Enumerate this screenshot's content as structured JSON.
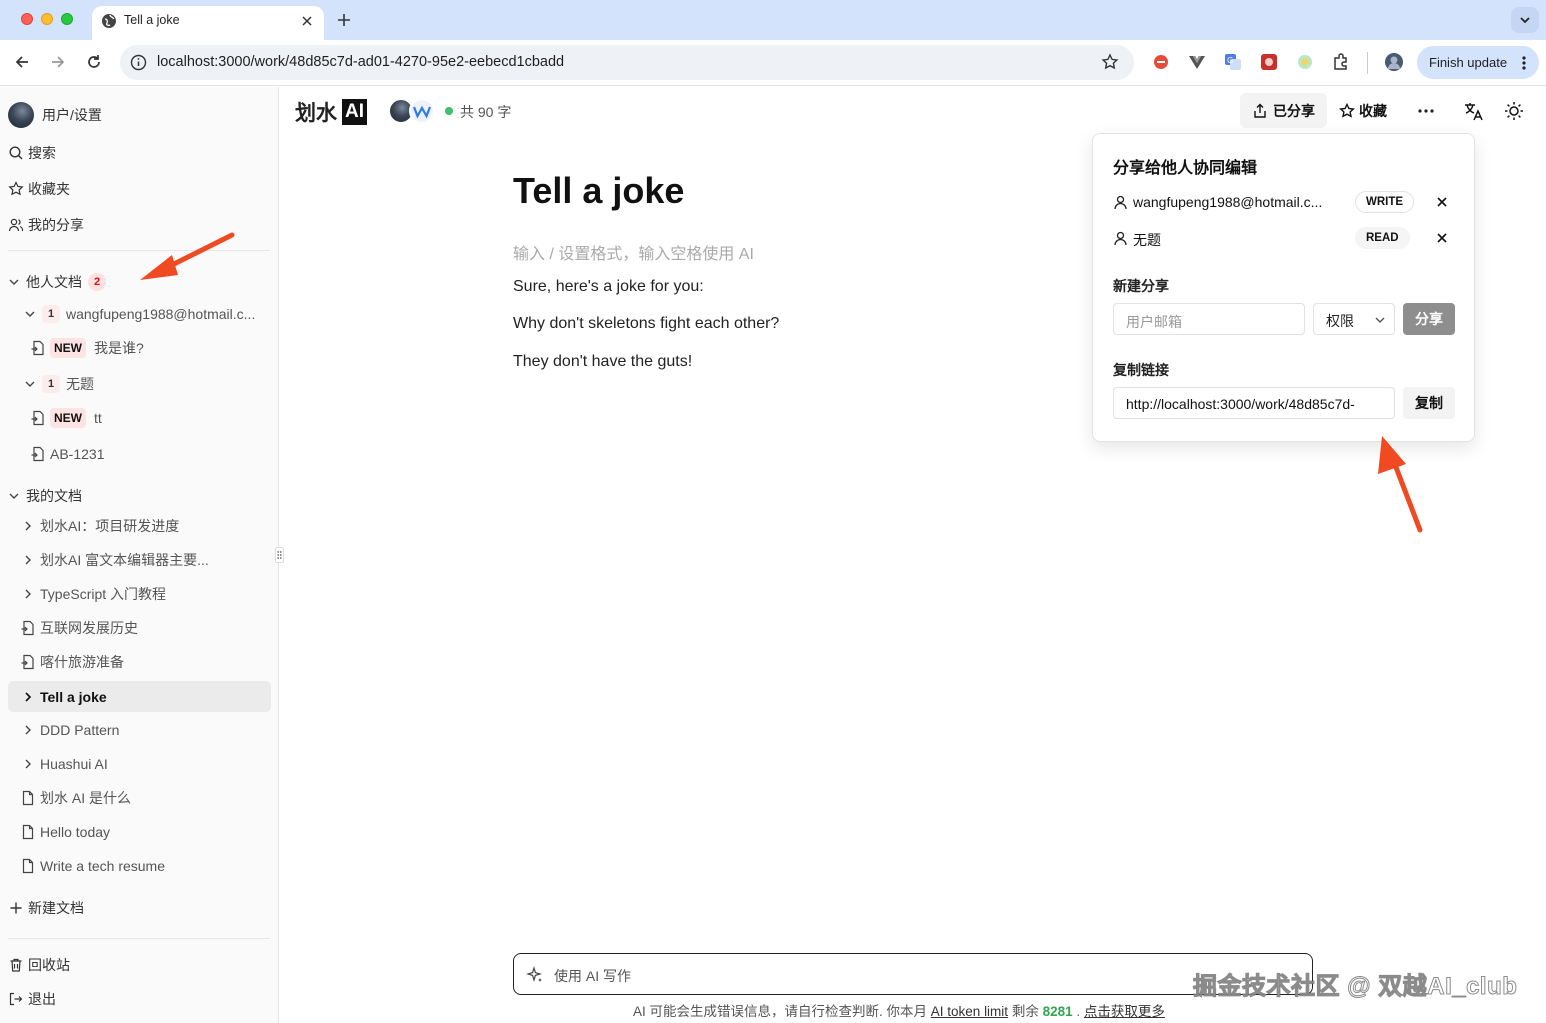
{
  "browser": {
    "tab_title": "Tell a joke",
    "url": "localhost:3000/work/48d85c7d-ad01-4270-95e2-eebecd1cbadd",
    "finish_update": "Finish update"
  },
  "sidebar": {
    "user_settings": "用户/设置",
    "search": "搜索",
    "favorites": "收藏夹",
    "my_shares": "我的分享",
    "others_docs": {
      "label": "他人文档",
      "count": "2"
    },
    "shared_groups": [
      {
        "count": "1",
        "owner": "wangfupeng1988@hotmail.c...",
        "doc_badge": "NEW",
        "doc_title": "我是谁?"
      },
      {
        "count": "1",
        "owner": "无题",
        "doc_badge": "NEW",
        "doc_title": "tt"
      }
    ],
    "shared_extra_doc": "AB-1231",
    "my_docs": {
      "label": "我的文档",
      "items": [
        "划水AI：项目研发进度",
        "划水AI 富文本编辑器主要...",
        "TypeScript 入门教程",
        "互联网发展历史",
        "喀什旅游准备",
        "Tell a joke",
        "DDD Pattern",
        "Huashui AI",
        "划水 AI 是什么",
        "Hello today",
        "Write a tech resume"
      ]
    },
    "new_doc": "新建文档",
    "trash": "回收站",
    "logout": "退出"
  },
  "header": {
    "logo_text": "划水",
    "logo_badge": "AI",
    "word_count": "共 90 字",
    "shared_btn": "已分享",
    "fav_btn": "收藏"
  },
  "document": {
    "title": "Tell a joke",
    "placeholder": "输入 / 设置格式，输入空格使用 AI",
    "paragraphs": [
      "Sure, here's a joke for you:",
      "Why don't skeletons fight each other?",
      "They don't have the guts!"
    ]
  },
  "share_popover": {
    "title": "分享给他人协同编辑",
    "users": [
      {
        "name": "wangfupeng1988@hotmail.c...",
        "permission": "WRITE"
      },
      {
        "name": "无题",
        "permission": "READ"
      }
    ],
    "new_share_label": "新建分享",
    "email_placeholder": "用户邮箱",
    "permission_select": "权限",
    "share_btn": "分享",
    "copy_link_label": "复制链接",
    "link_value": "http://localhost:3000/work/48d85c7d-",
    "copy_btn": "复制"
  },
  "ai_input": {
    "placeholder": "使用 AI 写作"
  },
  "footer": {
    "prefix": "AI 可能会生成错误信息，请自行检查判断. 你本月",
    "token_link": "AI token limit",
    "remaining_label": "剩余",
    "remaining": "8281",
    "get_more": "点击获取更多"
  },
  "watermark": "掘金技术社区 @ 双越AI_club",
  "colors": {
    "accent_arrow": "#f04a22",
    "online": "#3fc06a",
    "tab_strip": "#d4e3fc"
  }
}
